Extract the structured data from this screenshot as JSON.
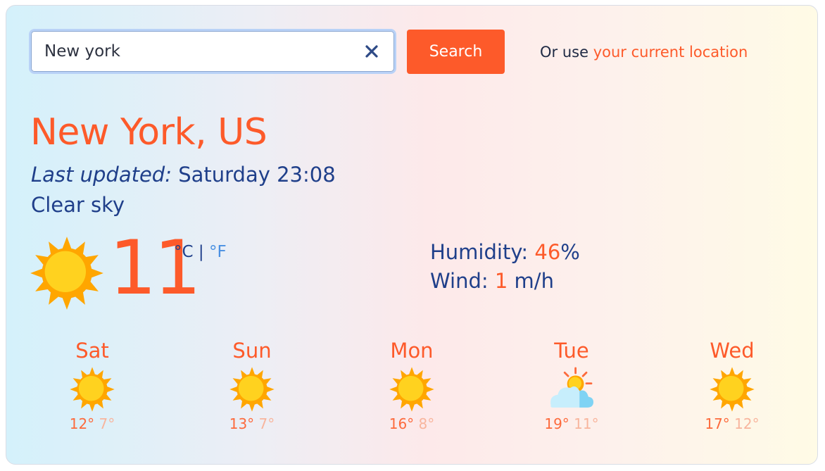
{
  "search": {
    "value": "New york",
    "button_label": "Search"
  },
  "location": {
    "prefix": "Or use ",
    "link": "your current location"
  },
  "current": {
    "city": "New York, US",
    "updated_label": "Last updated:",
    "updated_value": " Saturday 23:08",
    "condition": "Clear sky",
    "icon": "sun-icon",
    "temp": "11",
    "unit_c": "°C",
    "unit_sep": "|",
    "unit_f": "°F",
    "humidity_label": "Humidity: ",
    "humidity_value": "46",
    "humidity_unit": "%",
    "wind_label": "Wind: ",
    "wind_value": "1",
    "wind_unit": " m/h"
  },
  "forecast": [
    {
      "day": "Sat",
      "icon": "sun-icon",
      "max": "12°",
      "min": "7°"
    },
    {
      "day": "Sun",
      "icon": "sun-icon",
      "max": "13°",
      "min": "7°"
    },
    {
      "day": "Mon",
      "icon": "sun-icon",
      "max": "16°",
      "min": "8°"
    },
    {
      "day": "Tue",
      "icon": "partly-cloudy-icon",
      "max": "19°",
      "min": "11°"
    },
    {
      "day": "Wed",
      "icon": "sun-icon",
      "max": "17°",
      "min": "12°"
    }
  ],
  "colors": {
    "accent": "#fd5a2a",
    "text": "#1f3f8a",
    "sun": "#ffd21f",
    "sun_rays": "#ffa600"
  }
}
